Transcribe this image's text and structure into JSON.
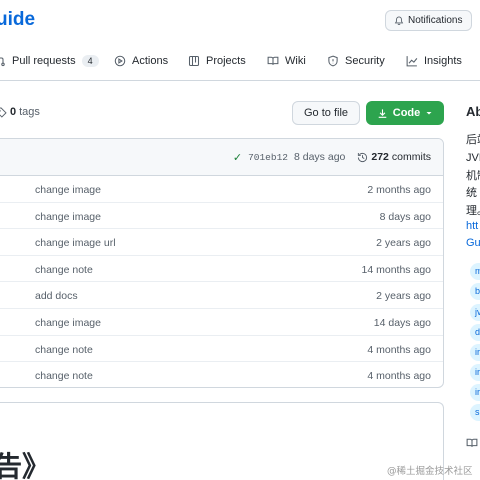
{
  "repo": {
    "title_fragment": "uide"
  },
  "header": {
    "notifications_label": "Notifications"
  },
  "tabs": [
    {
      "label": "Pull requests",
      "count": "4",
      "icon": "pull-request-icon"
    },
    {
      "label": "Actions",
      "icon": "play-icon"
    },
    {
      "label": "Projects",
      "icon": "table-icon"
    },
    {
      "label": "Wiki",
      "icon": "book-icon"
    },
    {
      "label": "Security",
      "icon": "shield-icon"
    },
    {
      "label": "Insights",
      "icon": "graph-icon"
    }
  ],
  "toolbar": {
    "tags_count": "0",
    "tags_label": "tags",
    "goto_label": "Go to file",
    "code_label": "Code"
  },
  "latest_commit": {
    "sha": "701eb12",
    "age": "8 days ago",
    "commits_count": "272",
    "commits_label": "commits"
  },
  "files": [
    {
      "message": "change image",
      "age": "2 months ago"
    },
    {
      "message": "change image",
      "age": "8 days ago"
    },
    {
      "message": "change image url",
      "age": "2 years ago"
    },
    {
      "message": "change note",
      "age": "14 months ago"
    },
    {
      "message": "add docs",
      "age": "2 years ago"
    },
    {
      "message": "change image",
      "age": "14 days ago"
    },
    {
      "message": "change note",
      "age": "4 months ago"
    },
    {
      "message": "change note",
      "age": "4 months ago"
    }
  ],
  "readme": {
    "heading_fragment": "告》"
  },
  "about": {
    "title_fragment": "Ab",
    "desc_lines": [
      "后端",
      "JVM",
      "机制",
      "统 ",
      "理。"
    ],
    "link_lines": [
      "htt",
      "Gu"
    ],
    "topics": [
      "m",
      "b",
      "jv",
      "d",
      "ir",
      "ir",
      "ir",
      "s"
    ]
  },
  "watermark": "@稀土掘金技术社区",
  "colors": {
    "accent": "#0969da",
    "success": "#2da44e",
    "border": "#d0d7de"
  }
}
